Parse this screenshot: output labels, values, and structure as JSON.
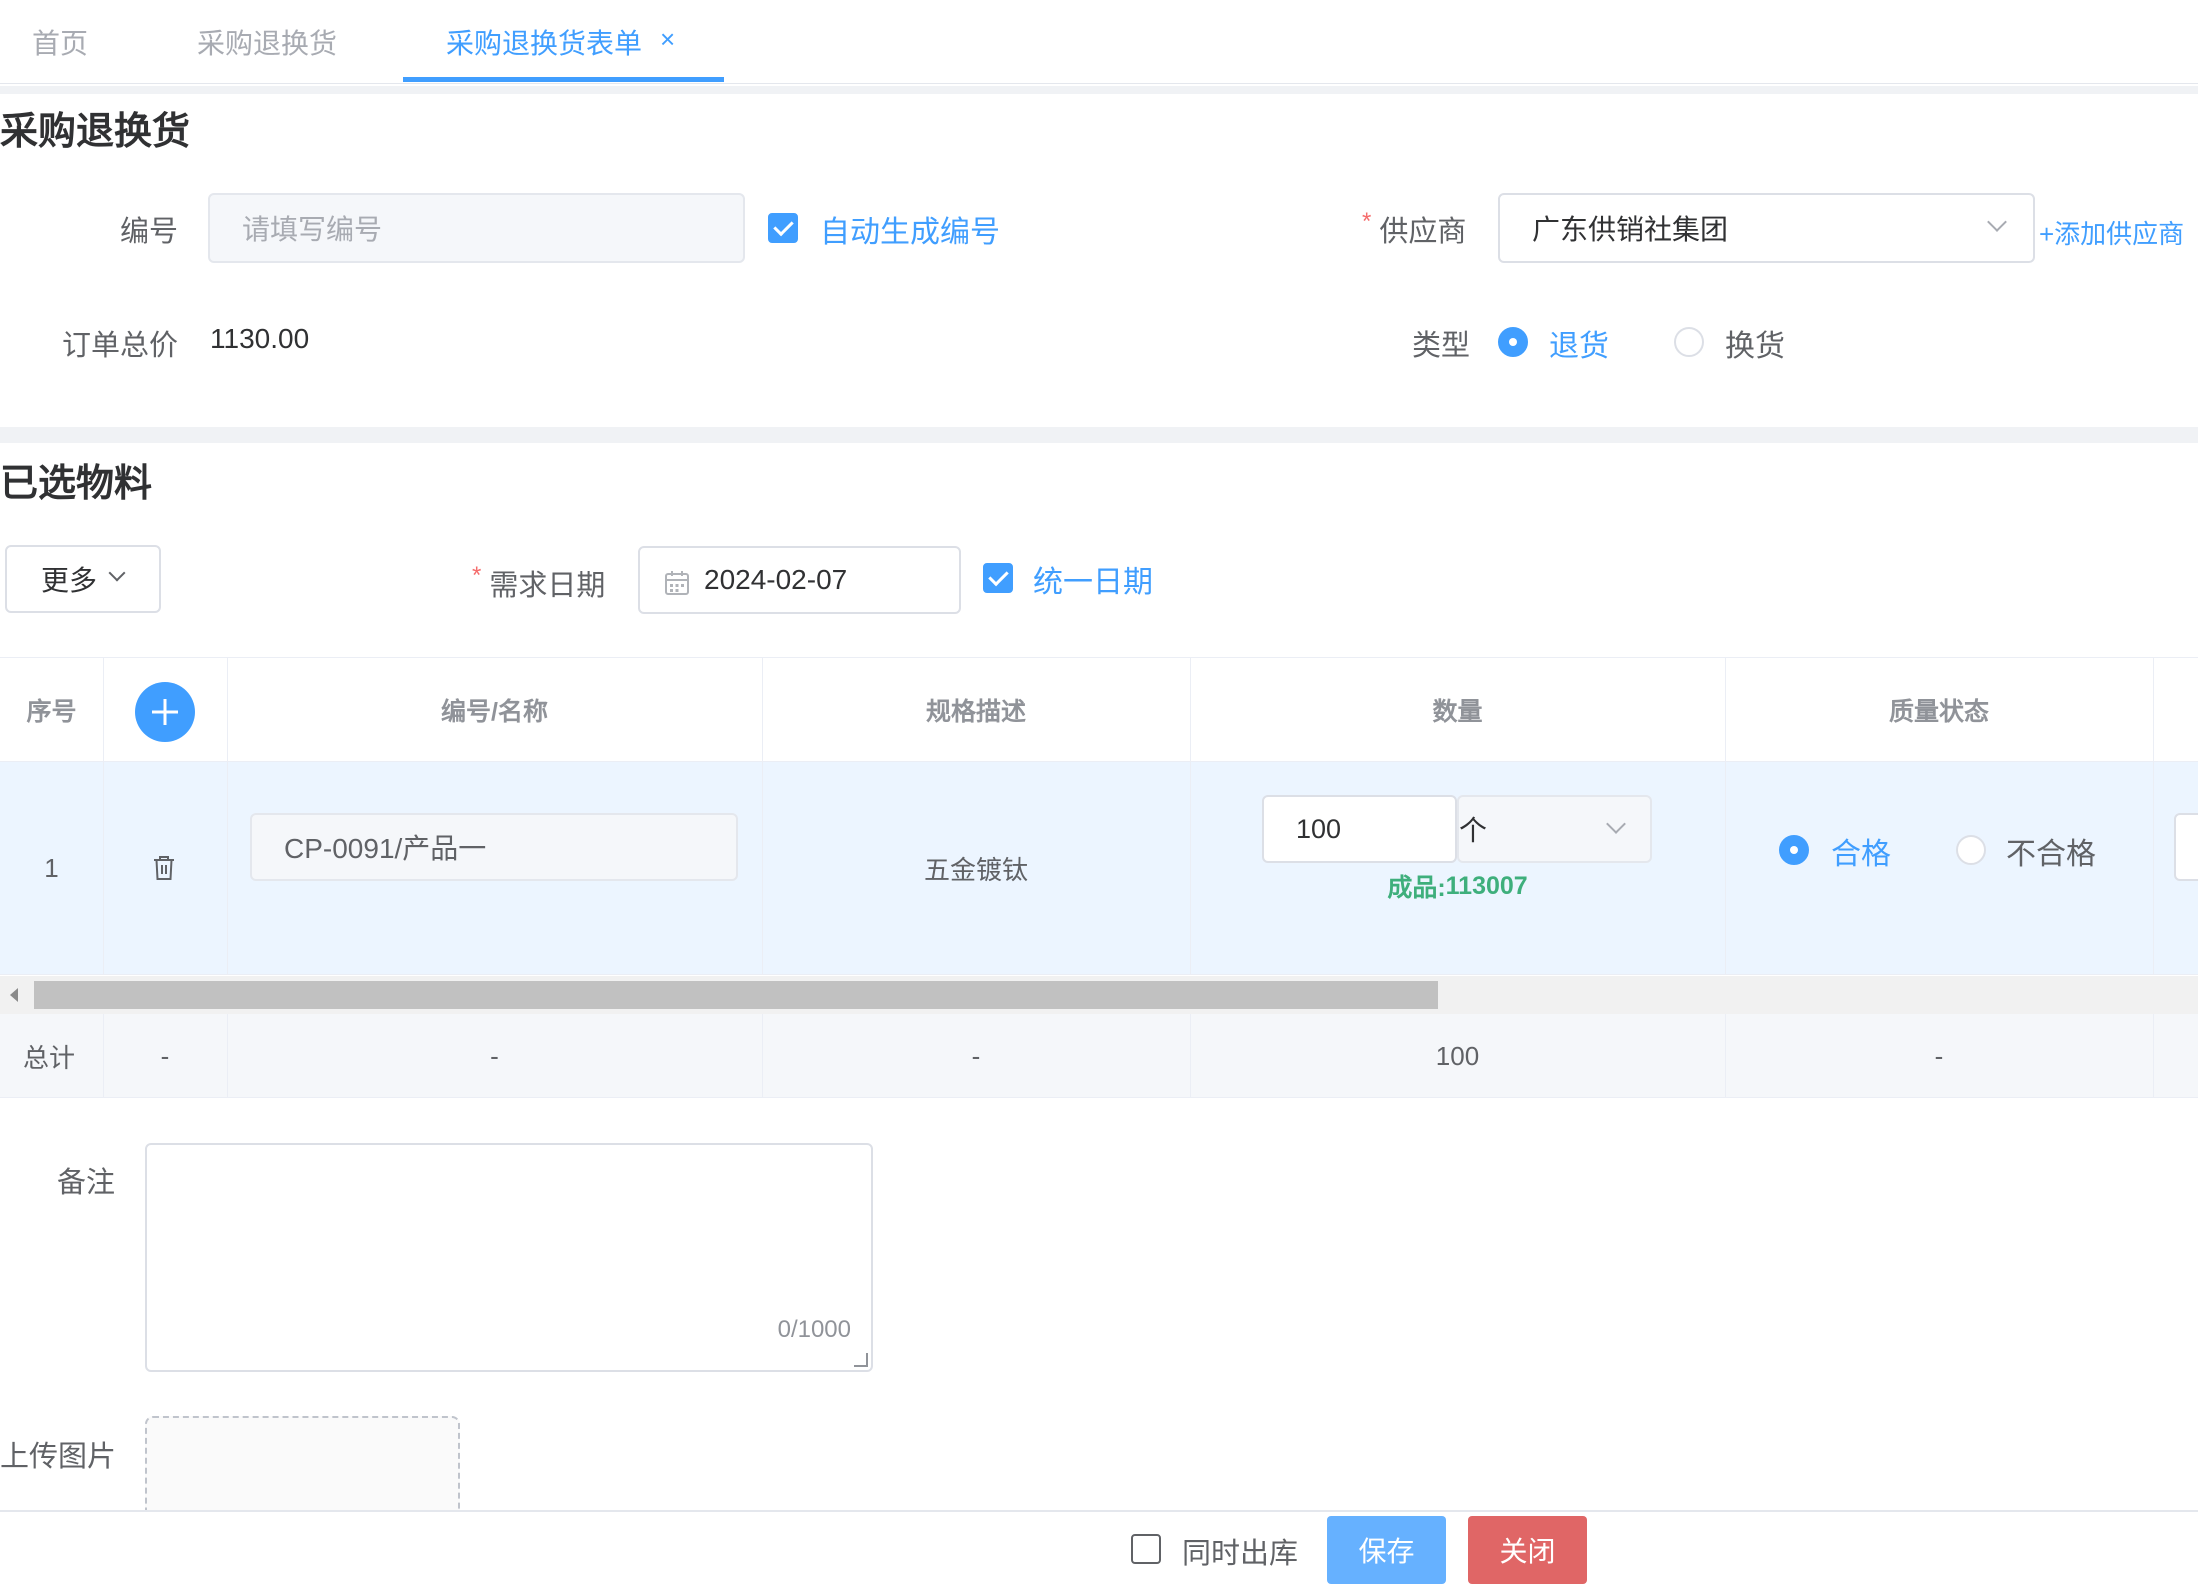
{
  "tabs": [
    {
      "label": "首页"
    },
    {
      "label": "采购退换货"
    },
    {
      "label": "采购退换货表单",
      "close": "×"
    }
  ],
  "form": {
    "title": "采购退换货",
    "code_label": "编号",
    "code_placeholder": "请填写编号",
    "auto_code_label": "自动生成编号",
    "auto_code_checked": true,
    "supplier_label": "供应商",
    "supplier_required": "*",
    "supplier_value": "广东供销社集团",
    "add_supplier_link": "+添加供应商",
    "total_label": "订单总价",
    "total_value": "1130.00",
    "type_label": "类型",
    "type_options": [
      "退货",
      "换货"
    ],
    "type_selected": "退货"
  },
  "materials": {
    "title": "已选物料",
    "more_button": "更多",
    "date_label": "需求日期",
    "date_required": "*",
    "date_value": "2024-02-07",
    "unify_date_label": "统一日期",
    "unify_date_checked": true
  },
  "table": {
    "headers": {
      "index": "序号",
      "code_name": "编号/名称",
      "spec": "规格描述",
      "qty": "数量",
      "quality": "质量状态"
    },
    "rows": [
      {
        "index": "1",
        "code_name": "CP-0091/产品一",
        "spec": "五金镀钛",
        "qty": "100",
        "unit": "个",
        "stock_prefix": "成品:",
        "stock_value": "113007",
        "quality_options": [
          "合格",
          "不合格"
        ],
        "quality_selected": "合格"
      }
    ],
    "summary": {
      "label": "总计",
      "c2": "-",
      "c3": "-",
      "c4": "-",
      "qty": "100",
      "c6": "-"
    }
  },
  "remark": {
    "label": "备注",
    "counter": "0/1000"
  },
  "upload": {
    "label": "上传图片"
  },
  "footer": {
    "stock_out_label": "同时出库",
    "stock_out_checked": false,
    "save_button": "保存",
    "close_button": "关闭"
  },
  "colors": {
    "primary": "#409eff",
    "danger": "#e06666",
    "success": "#3eaf7c",
    "save_bg": "#66b1ff"
  },
  "icons": [
    "close-icon",
    "checkbox-checked-icon",
    "chevron-down-icon",
    "calendar-icon",
    "plus-icon",
    "trash-icon",
    "scroll-left-arrow-icon",
    "resize-handle-icon"
  ]
}
